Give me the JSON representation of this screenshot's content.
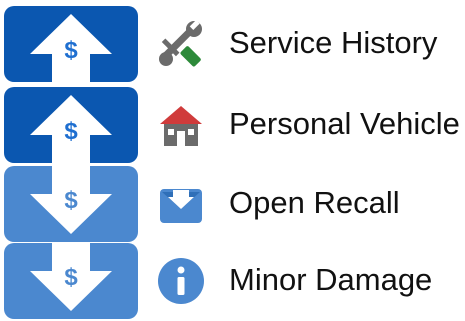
{
  "colors": {
    "tile_dark_blue": "#0b57b0",
    "tile_light_blue": "#4b88cf",
    "arrow_white": "#ffffff",
    "dollar_blue": "#1f6fd0",
    "icon_gray": "#6b6b6b",
    "icon_green": "#2d8a3a",
    "icon_red": "#d03b3b",
    "icon_blue": "#4b88cf",
    "text": "#111111"
  },
  "rows": [
    {
      "label": "Service History",
      "tile_icon": "arrow-up-dollar-icon",
      "tile_style": "dark",
      "icon": "wrench-screwdriver-icon"
    },
    {
      "label": "Personal Vehicle",
      "tile_icon": "arrow-up-dollar-icon",
      "tile_style": "dark",
      "icon": "house-icon"
    },
    {
      "label": "Open Recall",
      "tile_icon": "arrow-down-dollar-icon",
      "tile_style": "light",
      "icon": "envelope-icon"
    },
    {
      "label": "Minor Damage",
      "tile_icon": "arrow-down-dollar-icon",
      "tile_style": "light",
      "icon": "info-icon"
    }
  ],
  "tile_glyph": "$"
}
